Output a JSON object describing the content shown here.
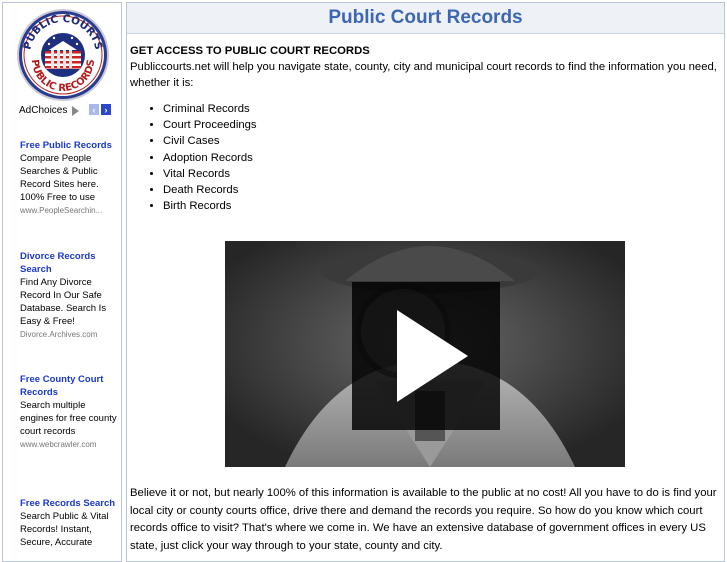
{
  "logo": {
    "top_text": "PUBLIC COURTS",
    "bottom_text": "PUBLIC RECORDS"
  },
  "ads": {
    "adchoices_label": "AdChoices",
    "items": [
      {
        "title_lines": [
          "Free Public Records"
        ],
        "desc": "Compare People Searches & Public Record Sites here. 100% Free to use",
        "url": "www.PeopleSearchin..."
      },
      {
        "title_lines": [
          "Divorce Records",
          "Search"
        ],
        "desc": "Find Any Divorce Record In Our Safe Database. Search Is Easy & Free!",
        "url": "Divorce.Archives.com"
      },
      {
        "title_lines": [
          "Free County Court",
          "Records"
        ],
        "desc": "Search multiple engines for free county court records",
        "url": "www.webcrawler.com"
      },
      {
        "title_lines": [
          "Free Records Search"
        ],
        "desc": "Search Public & Vital Records! Instant, Secure, Accurate",
        "url": ""
      }
    ]
  },
  "main": {
    "title": "Public Court Records",
    "heading": "GET ACCESS TO PUBLIC COURT RECORDS",
    "intro": "Publiccourts.net will help you navigate state, county, city and municipal court records to find the information you need, whether it is:",
    "list": [
      "Criminal Records",
      "Court Proceedings",
      "Civil Cases",
      "Adoption Records",
      "Vital Records",
      "Death Records",
      "Birth Records"
    ],
    "bottom": "Believe it or not, but nearly 100% of this information is available to the public at no cost! All you have to do is find your local city or county courts office, drive there and demand the records you require. So how do you know which court records office to visit? That's where we come in. We have an extensive database of government offices in every US state, just click your way through to your state, county and city."
  }
}
